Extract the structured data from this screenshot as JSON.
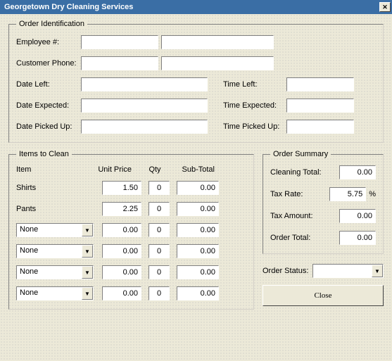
{
  "title": "Georgetown Dry Cleaning Services",
  "order_id": {
    "legend": "Order Identification",
    "employee_label": "Employee #:",
    "employee_a": "",
    "employee_b": "",
    "customer_label": "Customer Phone:",
    "customer_a": "",
    "customer_b": "",
    "date_left_label": "Date Left:",
    "date_left": "",
    "time_left_label": "Time Left:",
    "time_left": "",
    "date_expected_label": "Date Expected:",
    "date_expected": "",
    "time_expected_label": "Time Expected:",
    "time_expected": "",
    "date_picked_label": "Date Picked Up:",
    "date_picked": "",
    "time_picked_label": "Time Picked Up:",
    "time_picked": ""
  },
  "items": {
    "legend": "Items to Clean",
    "hdr_item": "Item",
    "hdr_up": "Unit Price",
    "hdr_qty": "Qty",
    "hdr_sub": "Sub-Total",
    "rows": [
      {
        "name": "Shirts",
        "up": "1.50",
        "qty": "0",
        "sub": "0.00",
        "combo": false
      },
      {
        "name": "Pants",
        "up": "2.25",
        "qty": "0",
        "sub": "0.00",
        "combo": false
      },
      {
        "name": "None",
        "up": "0.00",
        "qty": "0",
        "sub": "0.00",
        "combo": true
      },
      {
        "name": "None",
        "up": "0.00",
        "qty": "0",
        "sub": "0.00",
        "combo": true
      },
      {
        "name": "None",
        "up": "0.00",
        "qty": "0",
        "sub": "0.00",
        "combo": true
      },
      {
        "name": "None",
        "up": "0.00",
        "qty": "0",
        "sub": "0.00",
        "combo": true
      }
    ]
  },
  "summary": {
    "legend": "Order Summary",
    "cleaning_label": "Cleaning Total:",
    "cleaning": "0.00",
    "taxrate_label": "Tax Rate:",
    "taxrate": "5.75",
    "pct": "%",
    "taxamt_label": "Tax Amount:",
    "taxamt": "0.00",
    "total_label": "Order Total:",
    "total": "0.00"
  },
  "status_label": "Order Status:",
  "status": "",
  "close_label": "Close"
}
